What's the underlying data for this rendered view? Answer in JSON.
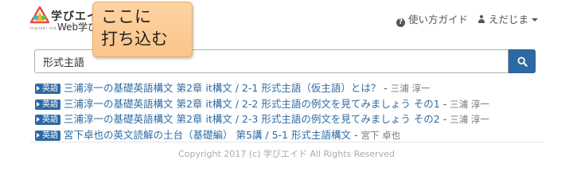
{
  "header": {
    "logo_brand": "学びエイド",
    "logo_small": "manabi aid",
    "site_title": "Web学びエイド版",
    "nav": {
      "guide": "使い方ガイド",
      "user": "えだじま"
    }
  },
  "callout": {
    "text": "ここに\n打ち込む"
  },
  "search": {
    "value": "形式主語"
  },
  "results": [
    {
      "badge": "英語",
      "title": "三浦淳一の基礎英語構文 第2章 it構文 / 2-1 形式主語（仮主語）とは？",
      "author": "三浦 淳一"
    },
    {
      "badge": "英語",
      "title": "三浦淳一の基礎英語構文 第2章 it構文 / 2-2 形式主語の例文を見てみましょう その1",
      "author": "三浦 淳一"
    },
    {
      "badge": "英語",
      "title": "三浦淳一の基礎英語構文 第2章 it構文 / 2-3 形式主語の例文を見てみましょう その2",
      "author": "三浦 淳一"
    },
    {
      "badge": "英語",
      "title": "宮下卓也の英文読解の土台（基礎編） 第5講 / 5-1 形式主語構文",
      "author": "宮下 卓也"
    }
  ],
  "footer": {
    "copyright": "Copyright 2017 (c) 学びエイド All Rights Reserved"
  },
  "colors": {
    "accent": "#2d6aa3",
    "callout": "#fbc489"
  },
  "icons": {
    "search": "search-icon",
    "help": "question-circle-icon",
    "user": "user-icon",
    "dropdown": "caret-down-icon"
  }
}
